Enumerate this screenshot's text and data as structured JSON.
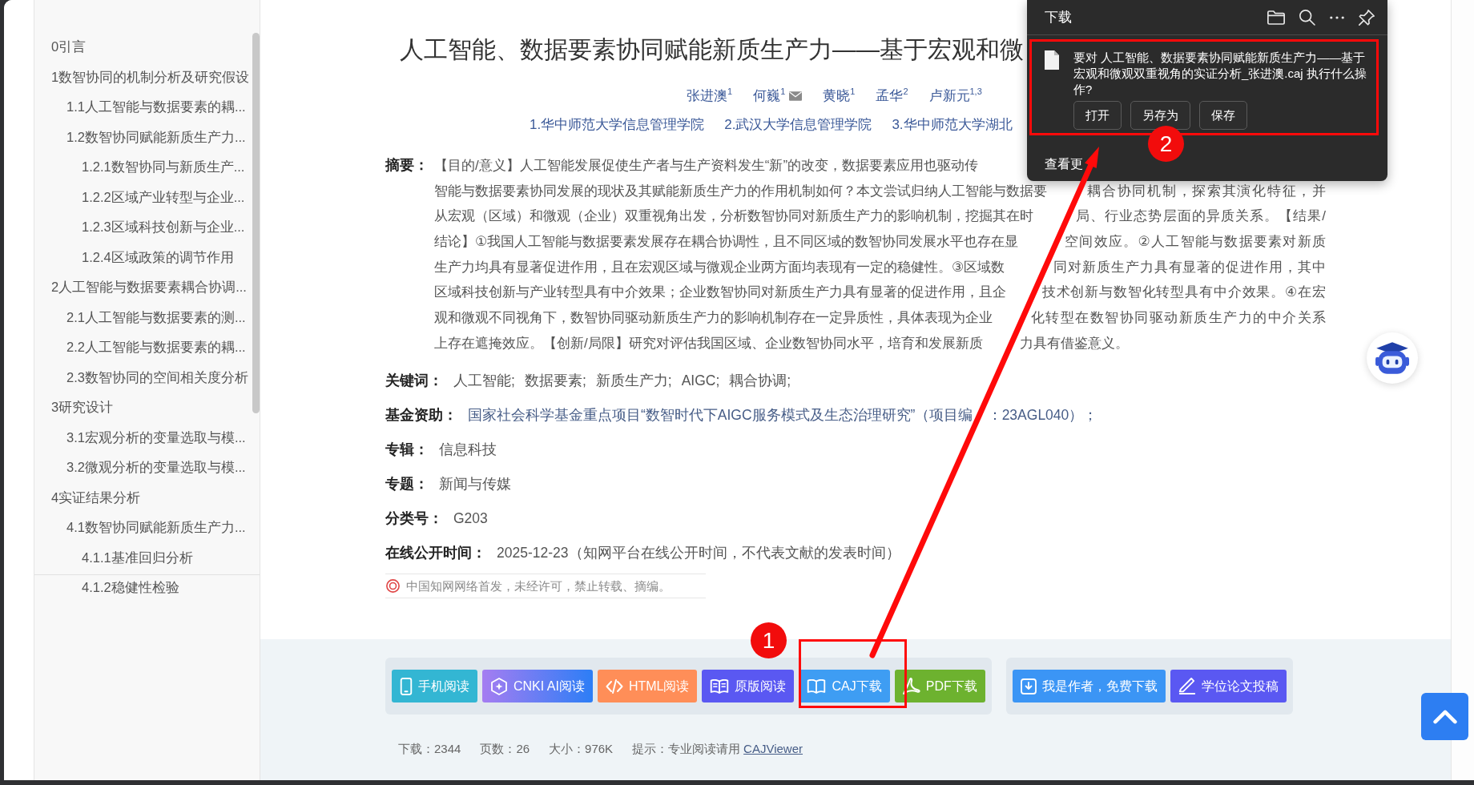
{
  "toc": {
    "items": [
      {
        "title": "0引言"
      },
      {
        "title": "1数智协同的机制分析及研究假设",
        "children": [
          {
            "title": "1.1人工智能与数据要素的耦..."
          },
          {
            "title": "1.2数智协同赋能新质生产力...",
            "children": [
              {
                "title": "1.2.1数智协同与新质生产..."
              },
              {
                "title": "1.2.2区域产业转型与企业..."
              },
              {
                "title": "1.2.3区域科技创新与企业..."
              },
              {
                "title": "1.2.4区域政策的调节作用"
              }
            ]
          }
        ]
      },
      {
        "title": "2人工智能与数据要素耦合协调...",
        "children": [
          {
            "title": "2.1人工智能与数据要素的测..."
          },
          {
            "title": "2.2人工智能与数据要素的耦..."
          },
          {
            "title": "2.3数智协同的空间相关度分析"
          }
        ]
      },
      {
        "title": "3研究设计",
        "children": [
          {
            "title": "3.1宏观分析的变量选取与模..."
          },
          {
            "title": "3.2微观分析的变量选取与模..."
          }
        ]
      },
      {
        "title": "4实证结果分析",
        "children": [
          {
            "title": "4.1数智协同赋能新质生产力...",
            "children": [
              {
                "title": "4.1.1基准回归分析"
              },
              {
                "title": "4.1.2稳健性检验"
              }
            ]
          }
        ]
      }
    ]
  },
  "article": {
    "title": "人工智能、数据要素协同赋能新质生产力——基于宏观和微",
    "authors": [
      {
        "name": "张进澳$^{1}$",
        "email": false
      },
      {
        "name": "何巍$^{1}$",
        "email": true
      },
      {
        "name": "黄晓$^{1}$",
        "email": false
      },
      {
        "name": "孟华$^{2}$",
        "email": false
      },
      {
        "name": "卢新元$^{1,3}$",
        "email": false
      }
    ],
    "affiliations": [
      "1.华中师范大学信息管理学院",
      "2.武汉大学信息管理学院",
      "3.华中师范大学湖北"
    ],
    "abstract": {
      "label": "摘要：",
      "lines": [
        [
          "【目的/意义】人工智能发展促使生产者与生产资料发生“新”的改变，数据要素应用也驱动传"
        ],
        [
          "智能与数据要素协同发展的现状及其赋能新质生产力的作用机制如何？本文尝试归纳人工智能与数据要",
          "耦合协同机制，探索其演化特征，并"
        ],
        [
          "从宏观（区域）和微观（企业）双重视角出发，分析数智协同对新质生产力的影响机制，挖掘其在时",
          "局、行业态势层面的异质关系。【结果/"
        ],
        [
          "结论】①我国人工智能与数据要素发展存在耦合协调性，且不同区域的数智协同发展水平也存在显",
          "空间效应。②人工智能与数据要素对新质"
        ],
        [
          "生产力均具有显著促进作用，且在宏观区域与微观企业两方面均表现有一定的稳健性。③区域数",
          "同对新质生产力具有显著的促进作用，其中"
        ],
        [
          "区域科技创新与产业转型具有中介效果；企业数智协同对新质生产力具有显著的促进作用，且企",
          "技术创新与数智化转型具有中介效果。④在宏"
        ],
        [
          "观和微观不同视角下，数智协同驱动新质生产力的影响机制存在一定异质性，具体表现为企业",
          "化转型在数智协同驱动新质生产力的中介关系"
        ],
        [
          "上存在遮掩效应。【创新/局限】研究对评估我国区域、企业数智协同水平，培育和发展新质",
          "力具有借鉴意义。"
        ]
      ]
    },
    "fields": [
      {
        "kind": "keywords",
        "label": "关键词：",
        "values": [
          "人工智能;",
          "数据要素;",
          "新质生产力;",
          "AIGC;",
          "耦合协调;"
        ]
      },
      {
        "kind": "link",
        "label": "基金资助：",
        "parts": [
          "国家社会科学基金重点项目“数智时代下AIGC服务模式及生态治理研究”（项目编",
          "：23AGL040）；"
        ]
      },
      {
        "kind": "text",
        "label": "专辑：",
        "value": "信息科技"
      },
      {
        "kind": "text",
        "label": "专题：",
        "value": "新闻与传媒"
      },
      {
        "kind": "text",
        "label": "分类号：",
        "value": "G203"
      },
      {
        "kind": "text",
        "label": "在线公开时间：",
        "value": "2025-12-23（知网平台在线公开时间，不代表文献的发表时间）"
      }
    ],
    "notice": "中国知网网络首发，未经许可，禁止转载、摘编。"
  },
  "actions": {
    "groups": [
      {
        "buttons": [
          {
            "kind": "mobile",
            "label": "手机阅读"
          },
          {
            "kind": "ai",
            "label": "CNKI AI阅读"
          },
          {
            "kind": "html",
            "label": "HTML阅读"
          },
          {
            "kind": "original",
            "label": "原版阅读"
          },
          {
            "kind": "caj",
            "label": "CAJ下载"
          },
          {
            "kind": "pdf",
            "label": "PDF下载"
          }
        ]
      },
      {
        "buttons": [
          {
            "kind": "author",
            "label": "我是作者，免费下载"
          },
          {
            "kind": "thesis",
            "label": "学位论文投稿"
          }
        ]
      }
    ],
    "stats": [
      "下载：2344",
      "页数：26",
      "大小：976K"
    ],
    "hint": {
      "text": "提示：专业阅读请用",
      "link": "CAJViewer"
    }
  },
  "download_panel": {
    "title": "下载",
    "message": "要对 人工智能、数据要素协同赋能新质生产力——基于宏观和微观双重视角的实证分析_张进澳.caj 执行什么操作?",
    "buttons": [
      "打开",
      "另存为",
      "保存"
    ],
    "more": "查看更"
  },
  "annotations": [
    {
      "label": "1"
    },
    {
      "label": "2"
    }
  ]
}
